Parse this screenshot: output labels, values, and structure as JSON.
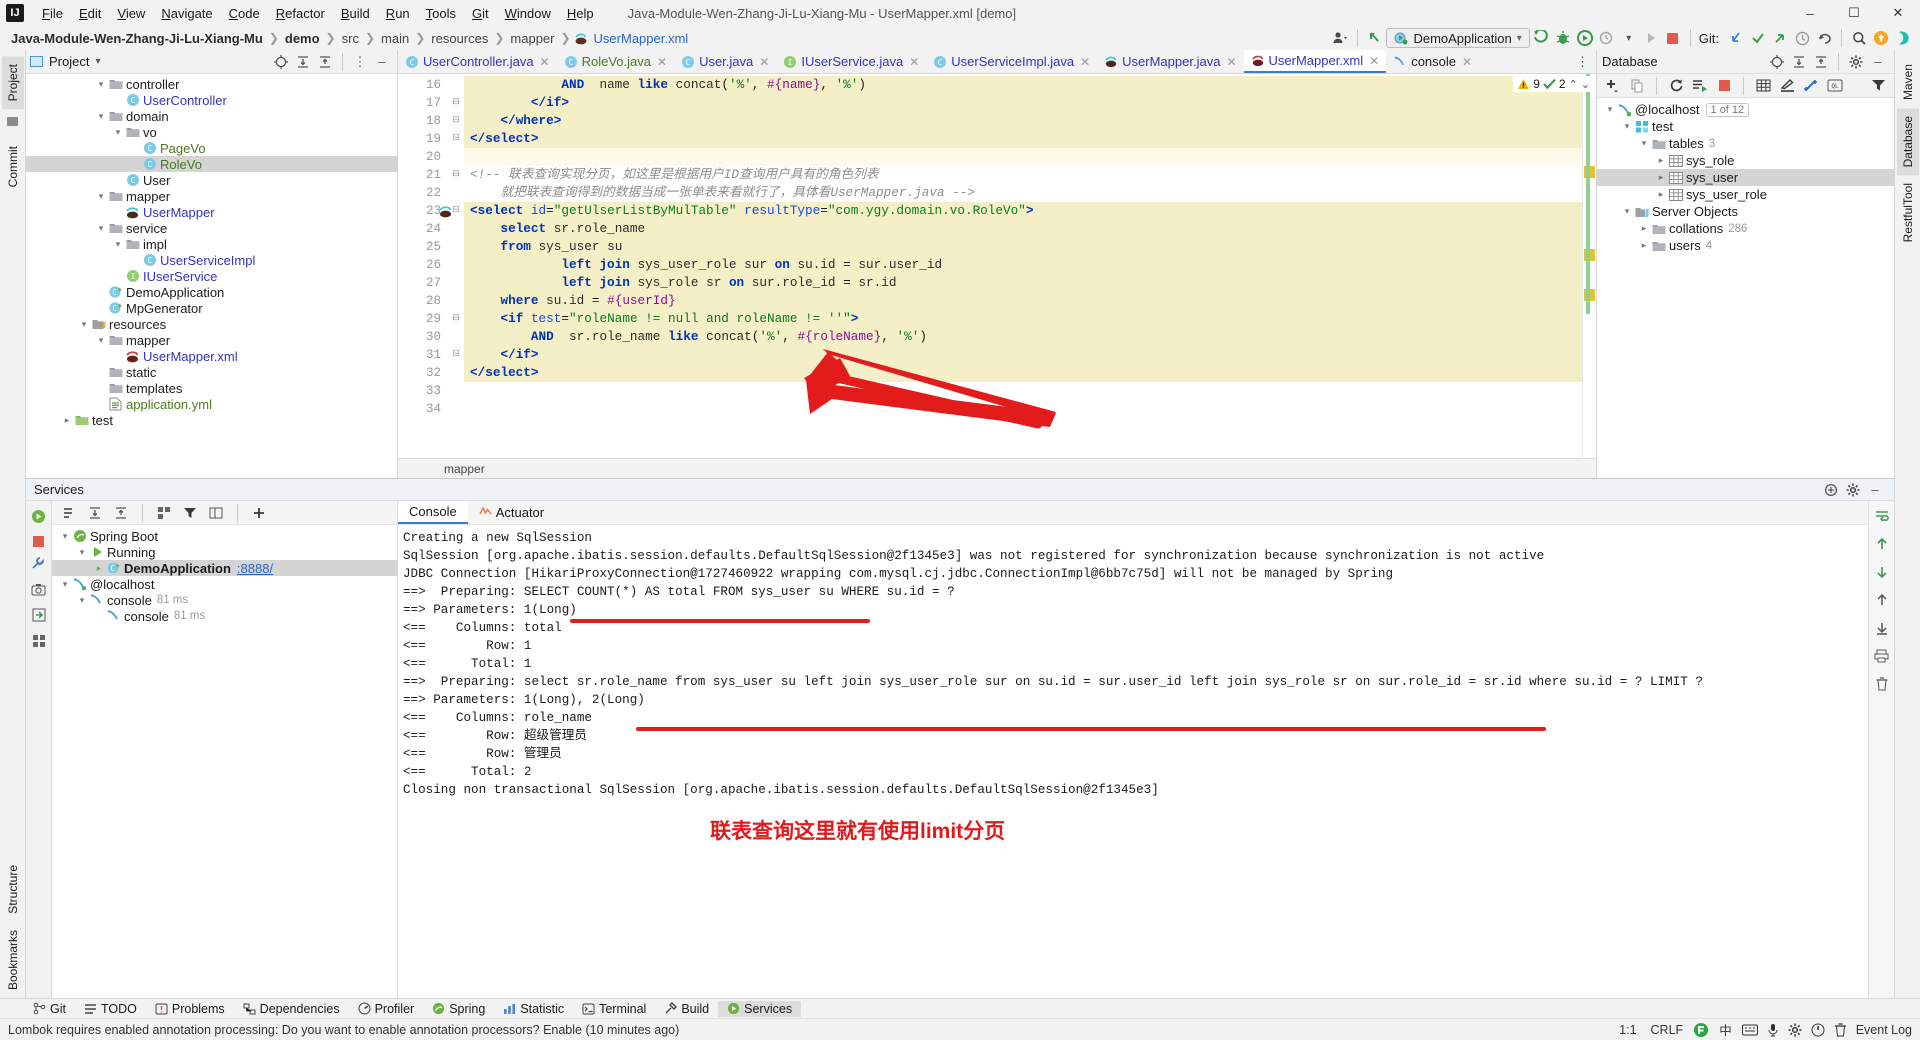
{
  "window": {
    "title": "Java-Module-Wen-Zhang-Ji-Lu-Xiang-Mu - UserMapper.xml [demo]",
    "logo": "IJ",
    "minimize": "–",
    "maximize": "☐",
    "close": "✕"
  },
  "menu": [
    "File",
    "Edit",
    "View",
    "Navigate",
    "Code",
    "Refactor",
    "Build",
    "Run",
    "Tools",
    "Git",
    "Window",
    "Help"
  ],
  "breadcrumbs": [
    {
      "label": "Java-Module-Wen-Zhang-Ji-Lu-Xiang-Mu",
      "style": "bold"
    },
    {
      "label": "demo",
      "style": "bold"
    },
    {
      "label": "src",
      "style": "dim"
    },
    {
      "label": "main",
      "style": "dim"
    },
    {
      "label": "resources",
      "style": "dim"
    },
    {
      "label": "mapper",
      "style": "dim"
    },
    {
      "label": "UserMapper.xml",
      "style": "link"
    }
  ],
  "toolbar": {
    "run_config": "DemoApplication",
    "git_label": "Git:",
    "search_icon": "search-icon",
    "updates_icon": "update-icon"
  },
  "left_rail": [
    "Project",
    "Commit"
  ],
  "right_rail": [
    "Maven",
    "Database",
    "RestfulTool"
  ],
  "bottom_rail": [
    "Structure",
    "Bookmarks"
  ],
  "project": {
    "title": "Project",
    "tree": [
      {
        "depth": 4,
        "arrow": "⌄",
        "icon": "folder",
        "label": "controller",
        "color": "c-dark"
      },
      {
        "depth": 5,
        "arrow": "",
        "icon": "class",
        "label": "UserController",
        "color": "c-blue"
      },
      {
        "depth": 4,
        "arrow": "⌄",
        "icon": "folder",
        "label": "domain",
        "color": "c-dark"
      },
      {
        "depth": 5,
        "arrow": "⌄",
        "icon": "folder",
        "label": "vo",
        "color": "c-dark"
      },
      {
        "depth": 6,
        "arrow": "",
        "icon": "class",
        "label": "PageVo",
        "color": "c-green"
      },
      {
        "depth": 6,
        "arrow": "",
        "icon": "class",
        "label": "RoleVo",
        "color": "c-green",
        "selected": true
      },
      {
        "depth": 5,
        "arrow": "",
        "icon": "class",
        "label": "User",
        "color": "c-dark"
      },
      {
        "depth": 4,
        "arrow": "⌄",
        "icon": "folder",
        "label": "mapper",
        "color": "c-dark"
      },
      {
        "depth": 5,
        "arrow": "",
        "icon": "mybatis",
        "label": "UserMapper",
        "color": "c-blue"
      },
      {
        "depth": 4,
        "arrow": "⌄",
        "icon": "folder",
        "label": "service",
        "color": "c-dark"
      },
      {
        "depth": 5,
        "arrow": "⌄",
        "icon": "folder",
        "label": "impl",
        "color": "c-dark"
      },
      {
        "depth": 6,
        "arrow": "",
        "icon": "class",
        "label": "UserServiceImpl",
        "color": "c-blue"
      },
      {
        "depth": 5,
        "arrow": "",
        "icon": "interface",
        "label": "IUserService",
        "color": "c-blue"
      },
      {
        "depth": 4,
        "arrow": "",
        "icon": "runapp",
        "label": "DemoApplication",
        "color": "c-dark"
      },
      {
        "depth": 4,
        "arrow": "",
        "icon": "runapp",
        "label": "MpGenerator",
        "color": "c-dark"
      },
      {
        "depth": 3,
        "arrow": "⌄",
        "icon": "resfolder",
        "label": "resources",
        "color": "c-dark"
      },
      {
        "depth": 4,
        "arrow": "⌄",
        "icon": "folder",
        "label": "mapper",
        "color": "c-dark"
      },
      {
        "depth": 5,
        "arrow": "",
        "icon": "mybatisxml",
        "label": "UserMapper.xml",
        "color": "c-blue"
      },
      {
        "depth": 4,
        "arrow": "",
        "icon": "folder",
        "label": "static",
        "color": "c-dark"
      },
      {
        "depth": 4,
        "arrow": "",
        "icon": "folder",
        "label": "templates",
        "color": "c-dark"
      },
      {
        "depth": 4,
        "arrow": "",
        "icon": "yaml",
        "label": "application.yml",
        "color": "c-green"
      },
      {
        "depth": 2,
        "arrow": "›",
        "icon": "testfolder",
        "label": "test",
        "color": "c-dark"
      }
    ]
  },
  "editor": {
    "tabs": [
      {
        "label": "UserController.java",
        "icon": "class-icon",
        "iconcolor": "#7ecbe8",
        "active": false
      },
      {
        "label": "RoleVo.java",
        "icon": "class-icon",
        "iconcolor": "#7ecbe8",
        "textcolor": "#4a7a20",
        "active": false
      },
      {
        "label": "User.java",
        "icon": "class-icon",
        "iconcolor": "#7ecbe8",
        "active": false
      },
      {
        "label": "IUserService.java",
        "icon": "interface-icon",
        "iconcolor": "#8fcf6e",
        "active": false
      },
      {
        "label": "UserServiceImpl.java",
        "icon": "class-icon",
        "iconcolor": "#7ecbe8",
        "active": false
      },
      {
        "label": "UserMapper.java",
        "icon": "mybatis-icon",
        "iconcolor": "#5a3020",
        "active": false
      },
      {
        "label": "UserMapper.xml",
        "icon": "mybatis-icon",
        "iconcolor": "#5a3020",
        "active": true
      },
      {
        "label": "console",
        "icon": "db-console-icon",
        "iconcolor": "#3b9ad1",
        "active": false
      }
    ],
    "inspections": {
      "warning_count": "9",
      "ok_count": "2",
      "up": "⌃",
      "down": "⌄"
    },
    "breadcrumb": "mapper",
    "first_line": 16,
    "lines": [
      {
        "n": 16,
        "hl": "full",
        "fold": "",
        "html": "            <span class=\"k\">AND</span>  <span class=\"ident\">name</span> <span class=\"k\">like</span> <span class=\"ident\">concat</span>(<span class=\"str\">'%'</span>, <span class=\"pl\">#{name}</span>, <span class=\"str\">'%'</span>)"
      },
      {
        "n": 17,
        "hl": "full",
        "fold": "⊟",
        "html": "        <span class=\"tag\">&lt;/if&gt;</span>"
      },
      {
        "n": 18,
        "hl": "full",
        "fold": "⊟",
        "html": "    <span class=\"tag\">&lt;/where&gt;</span>"
      },
      {
        "n": 19,
        "hl": "full",
        "fold": "⊟",
        "html": "<span class=\"tag\">&lt;/select&gt;</span>"
      },
      {
        "n": 20,
        "hl": "part",
        "fold": "",
        "html": ""
      },
      {
        "n": 21,
        "hl": "none",
        "fold": "⊟",
        "html": "<span class=\"cm\">&lt;!-- 联表查询实现分页，如这里是根据用户ID查询用户具有的角色列表</span>"
      },
      {
        "n": 22,
        "hl": "none",
        "fold": "",
        "html": "<span class=\"cm\">    就把联表查询得到的数据当成一张单表来看就行了，具体看UserMapper.java --&gt;</span>"
      },
      {
        "n": 23,
        "hl": "full",
        "fold": "⊟",
        "gutterIcon": "mybatis",
        "html": "<span class=\"tag\">&lt;select</span> <span class=\"attr\">id</span>=<span class=\"str\">\"getUlserListByMulTable\"</span> <span class=\"attr\">resultType</span>=<span class=\"str\">\"com.ygy.domain.vo.RoleVo\"</span><span class=\"tag\">&gt;</span>"
      },
      {
        "n": 24,
        "hl": "full",
        "fold": "",
        "html": "    <span class=\"k\">select</span> <span class=\"ident\">sr.role_name</span>"
      },
      {
        "n": 25,
        "hl": "full",
        "fold": "",
        "html": "    <span class=\"k\">from</span> <span class=\"ident\">sys_user</span> <span class=\"ident\">su</span>"
      },
      {
        "n": 26,
        "hl": "full",
        "fold": "",
        "html": "            <span class=\"k\">left join</span> <span class=\"ident\">sys_user_role</span> <span class=\"ident\">sur</span> <span class=\"k\">on</span> <span class=\"ident\">su.id</span> = <span class=\"ident\">sur.user_id</span>"
      },
      {
        "n": 27,
        "hl": "full",
        "fold": "",
        "html": "            <span class=\"k\">left join</span> <span class=\"ident\">sys_role</span> <span class=\"ident\">sr</span> <span class=\"k\">on</span> <span class=\"ident\">sur.role_id</span> = <span class=\"ident\">sr.id</span>"
      },
      {
        "n": 28,
        "hl": "full",
        "fold": "",
        "html": "    <span class=\"k\">where</span> <span class=\"ident\">su.id</span> = <span class=\"pl\">#{userId}</span>"
      },
      {
        "n": 29,
        "hl": "full",
        "fold": "⊟",
        "html": "    <span class=\"tag\">&lt;if</span> <span class=\"attr\">test</span>=<span class=\"str\">\"roleName != null and roleName != ''\"</span><span class=\"tag\">&gt;</span>"
      },
      {
        "n": 30,
        "hl": "full",
        "fold": "",
        "html": "        <span class=\"k\">AND</span>  <span class=\"ident\">sr.role_name</span> <span class=\"k\">like</span> <span class=\"ident\">concat</span>(<span class=\"str\">'%'</span>, <span class=\"pl\">#{roleName}</span>, <span class=\"str\">'%'</span>)"
      },
      {
        "n": 31,
        "hl": "full",
        "fold": "⊟",
        "html": "    <span class=\"tag\">&lt;/if&gt;</span>"
      },
      {
        "n": 32,
        "hl": "full",
        "fold": "",
        "html": "<span class=\"tag\">&lt;/select&gt;</span>"
      },
      {
        "n": 33,
        "hl": "none",
        "fold": "",
        "html": ""
      },
      {
        "n": 34,
        "hl": "none",
        "fold": "",
        "html": ""
      }
    ]
  },
  "database": {
    "title": "Database",
    "tree": [
      {
        "depth": 0,
        "arrow": "⌄",
        "icon": "connection",
        "label": "@localhost",
        "badge": "1 of 12"
      },
      {
        "depth": 1,
        "arrow": "⌄",
        "icon": "schema",
        "label": "test"
      },
      {
        "depth": 2,
        "arrow": "⌄",
        "icon": "folder",
        "label": "tables",
        "count": "3"
      },
      {
        "depth": 3,
        "arrow": "›",
        "icon": "table",
        "label": "sys_role"
      },
      {
        "depth": 3,
        "arrow": "›",
        "icon": "table",
        "label": "sys_user",
        "selected": true
      },
      {
        "depth": 3,
        "arrow": "›",
        "icon": "table",
        "label": "sys_user_role"
      },
      {
        "depth": 1,
        "arrow": "⌄",
        "icon": "serverobj",
        "label": "Server Objects"
      },
      {
        "depth": 2,
        "arrow": "›",
        "icon": "folder",
        "label": "collations",
        "count": "286"
      },
      {
        "depth": 2,
        "arrow": "›",
        "icon": "folder",
        "label": "users",
        "count": "4"
      }
    ]
  },
  "services": {
    "title": "Services",
    "tree": [
      {
        "depth": 0,
        "arrow": "⌄",
        "icon": "spring",
        "label": "Spring Boot"
      },
      {
        "depth": 1,
        "arrow": "⌄",
        "icon": "running",
        "label": "Running"
      },
      {
        "depth": 2,
        "arrow": "▶",
        "icon": "app",
        "label": "DemoApplication",
        "link": ":8888/",
        "selected": true
      },
      {
        "depth": 0,
        "arrow": "⌄",
        "icon": "connection",
        "label": "@localhost"
      },
      {
        "depth": 1,
        "arrow": "⌄",
        "icon": "console",
        "label": "console",
        "time": "81 ms"
      },
      {
        "depth": 2,
        "arrow": "",
        "icon": "console",
        "label": "console",
        "time": "81 ms"
      }
    ],
    "console_tabs": [
      {
        "label": "Console",
        "active": true
      },
      {
        "label": "Actuator",
        "active": false
      }
    ],
    "console_lines": [
      "Creating a new SqlSession",
      "SqlSession [org.apache.ibatis.session.defaults.DefaultSqlSession@2f1345e3] was not registered for synchronization because synchronization is not active",
      "JDBC Connection [HikariProxyConnection@1727460922 wrapping com.mysql.cj.jdbc.ConnectionImpl@6bb7c75d] will not be managed by Spring",
      "==>  Preparing: SELECT COUNT(*) AS total FROM sys_user su WHERE su.id = ?",
      "==> Parameters: 1(Long)",
      "<==    Columns: total",
      "<==        Row: 1",
      "<==      Total: 1",
      "==>  Preparing: select sr.role_name from sys_user su left join sys_user_role sur on su.id = sur.user_id left join sys_role sr on sur.role_id = sr.id where su.id = ? LIMIT ?",
      "==> Parameters: 1(Long), 2(Long)",
      "<==    Columns: role_name",
      "<==        Row: 超级管理员",
      "<==        Row: 管理员",
      "<==      Total: 2",
      "Closing non transactional SqlSession [org.apache.ibatis.session.defaults.DefaultSqlSession@2f1345e3]"
    ],
    "annotation": "联表查询这里就有使用limit分页"
  },
  "bottom_bar": [
    {
      "label": "Git",
      "icon": "branch-icon"
    },
    {
      "label": "TODO",
      "icon": "list-icon"
    },
    {
      "label": "Problems",
      "icon": "warning-icon"
    },
    {
      "label": "Dependencies",
      "icon": "deps-icon"
    },
    {
      "label": "Profiler",
      "icon": "profiler-icon"
    },
    {
      "label": "Spring",
      "icon": "spring-icon"
    },
    {
      "label": "Statistic",
      "icon": "stats-icon"
    },
    {
      "label": "Terminal",
      "icon": "terminal-icon"
    },
    {
      "label": "Build",
      "icon": "hammer-icon"
    },
    {
      "label": "Services",
      "icon": "services-icon",
      "active": true
    }
  ],
  "status": {
    "message": "Lombok requires enabled annotation processing: Do you want to enable annotation processors? Enable (10 minutes ago)",
    "caret": "1:1",
    "line_ending": "CRLF",
    "ime": "中",
    "event_log": "Event Log"
  },
  "colors": {
    "accent": "#3b7cd1",
    "highlight": "#f5efc8",
    "annotation_red": "#e21b1b",
    "keyword_blue": "#0033b3",
    "string_green": "#067d17",
    "placeholder_purple": "#871094"
  }
}
